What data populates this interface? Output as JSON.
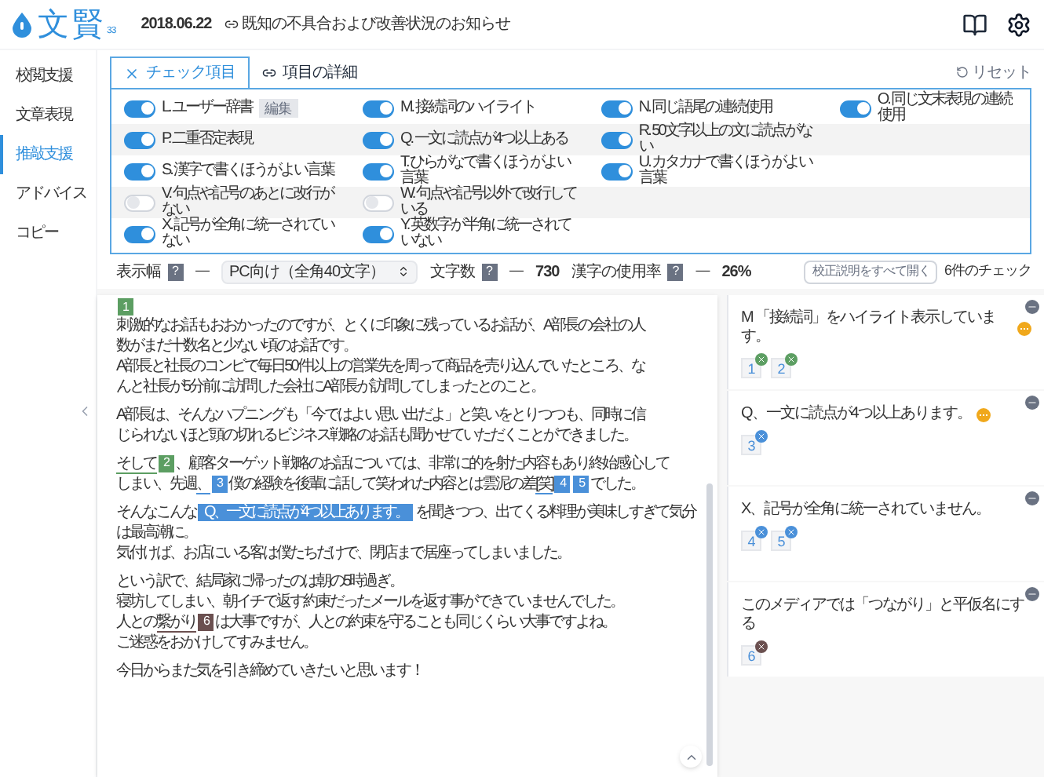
{
  "header": {
    "logo_text": "文賢",
    "version": "33",
    "date": "2018.06.22",
    "notice_link": "既知の不具合および改善状況のお知らせ"
  },
  "sidebar": {
    "items": [
      {
        "label": "校閲支援",
        "selected": false
      },
      {
        "label": "文章表現",
        "selected": false
      },
      {
        "label": "推敲支援",
        "selected": true
      },
      {
        "label": "アドバイス",
        "selected": false
      },
      {
        "label": "コピー",
        "selected": false
      }
    ]
  },
  "tabs": [
    {
      "label": "チェック項目",
      "selected": true
    },
    {
      "label": "項目の詳細",
      "selected": false
    }
  ],
  "reset_button": "リセット",
  "checklist": {
    "rows": [
      [
        {
          "label": "L. ユーザー辞書",
          "on": true,
          "button": "編集"
        },
        {
          "label": "M. 接続詞のハイライト",
          "on": true
        },
        {
          "label": "N. 同じ語尾の連続使用",
          "on": true
        },
        {
          "label": "O. 同じ文末表現の連続使用",
          "on": true
        }
      ],
      [
        {
          "label": "P. 二重否定表現",
          "on": true
        },
        {
          "label": "Q. 一文に読点が4つ以上ある",
          "on": true
        },
        {
          "label": "R. 50文字以上の文に読点がない",
          "on": true
        }
      ],
      [
        {
          "label": "S. 漢字で書くほうがよい言葉",
          "on": true
        },
        {
          "label": "T. ひらがなで書くほうがよい言葉",
          "on": true
        },
        {
          "label": "U. カタカナで書くほうがよい言葉",
          "on": true
        }
      ],
      [
        {
          "label": "V. 句点や記号のあとに改行がない",
          "on": false
        },
        {
          "label": "W. 句点や記号以外で改行している",
          "on": false
        }
      ],
      [
        {
          "label": "X. 記号が全角に統一されていない",
          "on": true
        },
        {
          "label": "Y. 英数字が半角に統一されていない",
          "on": true
        }
      ]
    ]
  },
  "toolbar": {
    "metrics": [
      {
        "label": "表示幅",
        "help": "?",
        "dash": "—",
        "kind": "select",
        "value": "PC向け（全角40文字）"
      },
      {
        "label": "文字数",
        "help": "?",
        "dash": "—",
        "kind": "text",
        "value": "730"
      },
      {
        "label": "漢字の使用率",
        "help": "?",
        "dash": "—",
        "kind": "text",
        "value": "26%"
      }
    ],
    "expand_button": "校正説明をすべて開く",
    "check_count": "6件のチェック"
  },
  "editor": {
    "paragraphs": [
      {
        "badge": {
          "label": "1",
          "color": "#5c9e62"
        },
        "lines": [
          [
            {
              "kind": "text",
              "text": "刺激的なお話もおおかったのですが、とくに印象に残っているお話が、A部長の会社の人"
            }
          ],
          [
            {
              "kind": "text",
              "text": "数がまだ十数名と少ない頃のお話です。"
            }
          ],
          [
            {
              "kind": "text",
              "text": "A部長と社長のコンビで毎日50件以上の営業先を周って商品を売り込んでいたところ、な"
            }
          ],
          [
            {
              "kind": "text",
              "text": "んと社長が5分前に訪問した会社にA部長が訪問してしまったとのこと。"
            }
          ]
        ]
      },
      {
        "lines": [
          [
            {
              "kind": "text",
              "text": "A部長は、そんなハプニングも「今ではよい思い出だよ」と笑いをとりつつも、同時に信"
            }
          ],
          [
            {
              "kind": "text",
              "text": "じられないほど頭の切れるビジネス戦略のお話も聞かせていただくことができました。"
            }
          ]
        ]
      },
      {
        "lines": [
          [
            {
              "kind": "mark",
              "text": "そして",
              "badges": [
                {
                  "label": "2",
                  "color": "#5c9e62"
                }
              ]
            },
            {
              "kind": "text",
              "text": "、顧客ターゲット戦略のお話については、非常に的を射た内容もあり終始感心して"
            }
          ],
          [
            {
              "kind": "text",
              "text": "しまい、先週"
            },
            {
              "kind": "mark",
              "text": "、",
              "badges": [
                {
                  "label": "3",
                  "color": "#4a90d9"
                }
              ]
            },
            {
              "kind": "text",
              "text": "僕の経験を後輩に話して笑われた内容とは雲泥の差"
            },
            {
              "kind": "mark",
              "text": "[笑]",
              "badges": [
                {
                  "label": "4",
                  "color": "#4a90d9"
                },
                {
                  "label": "5",
                  "color": "#4a90d9"
                }
              ]
            },
            {
              "kind": "text",
              "text": "でした。"
            }
          ]
        ]
      },
      {
        "lines": [
          [
            {
              "kind": "text",
              "text": "そんなこんな"
            },
            {
              "kind": "tooltip",
              "text": "Q、一文に読点が4つ以上あります。"
            },
            {
              "kind": "text",
              "text": "を聞きつつ、出てくる料理が美味しすぎて気分"
            }
          ],
          [
            {
              "kind": "text",
              "text": "は最高潮に。"
            }
          ],
          [
            {
              "kind": "text",
              "text": "気付けば、お店にいる客は僕たちだけで、閉店まで居座ってしまいました。"
            }
          ]
        ]
      },
      {
        "lines": [
          [
            {
              "kind": "text",
              "text": "という訳で、結局家に帰ったのは朝の5時過ぎ。"
            }
          ],
          [
            {
              "kind": "text",
              "text": "寝坊してしまい、朝イチで返す約束だったメールを返す事ができていませんでした。"
            }
          ],
          [
            {
              "kind": "text",
              "text": "人との"
            },
            {
              "kind": "mark",
              "text": "繋がり",
              "badges": [
                {
                  "label": "6",
                  "color": "#6b5050"
                }
              ]
            },
            {
              "kind": "text",
              "text": "は大事ですが、人との約束を守ることも同じくらい大事ですよね。"
            }
          ],
          [
            {
              "kind": "text",
              "text": "ご迷惑をおかけしてすみません。"
            }
          ]
        ]
      },
      {
        "lines": [
          [
            {
              "kind": "text",
              "text": "今日からまた気を引き締めていきたいと思います！"
            }
          ]
        ]
      }
    ]
  },
  "results": [
    {
      "title": "M 「接続詞」をハイライト表示しています。",
      "info": true,
      "refs": [
        {
          "label": "1",
          "color": "#5c9e62"
        },
        {
          "label": "2",
          "color": "#5c9e62"
        }
      ]
    },
    {
      "title": "Q、一文に読点が4つ以上あります。",
      "info": true,
      "refs": [
        {
          "label": "3",
          "color": "#4a90d9"
        }
      ]
    },
    {
      "title": "X、記号が全角に統一されていません。",
      "info": false,
      "refs": [
        {
          "label": "4",
          "color": "#4a90d9"
        },
        {
          "label": "5",
          "color": "#4a90d9"
        }
      ]
    },
    {
      "title": "このメディアでは「つながり」と平仮名にする",
      "info": false,
      "refs": [
        {
          "label": "6",
          "color": "#6b5050"
        }
      ]
    }
  ]
}
